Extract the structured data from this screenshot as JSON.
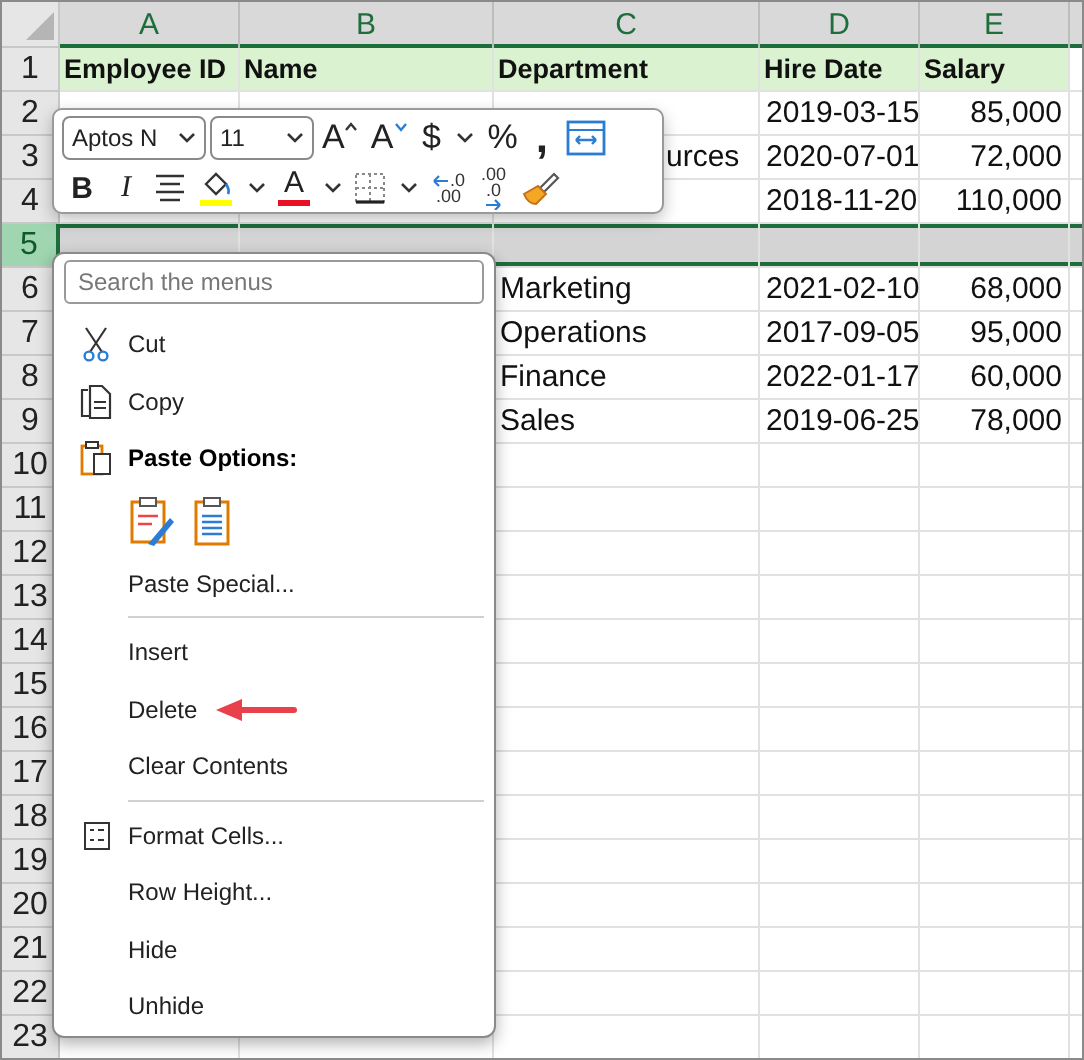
{
  "sheet": {
    "columns": [
      "A",
      "B",
      "C",
      "D",
      "E"
    ],
    "rows": [
      {
        "number": "1",
        "kind": "header",
        "selected": false,
        "cells": [
          "Employee ID",
          "Name",
          "Department",
          "Hire Date",
          "Salary"
        ]
      },
      {
        "number": "2",
        "kind": "data",
        "selected": false,
        "cells": [
          null,
          null,
          null,
          "2019-03-15",
          "85,000"
        ]
      },
      {
        "number": "3",
        "kind": "data",
        "selected": false,
        "cells": [
          null,
          null,
          "urces",
          "2020-07-01",
          "72,000"
        ]
      },
      {
        "number": "4",
        "kind": "data",
        "selected": false,
        "cells": [
          null,
          null,
          null,
          "2018-11-20",
          "110,000"
        ]
      },
      {
        "number": "5",
        "kind": "data",
        "selected": true,
        "cells": [
          null,
          null,
          null,
          null,
          null
        ]
      },
      {
        "number": "6",
        "kind": "data",
        "selected": false,
        "cells": [
          null,
          null,
          "Marketing",
          "2021-02-10",
          "68,000"
        ]
      },
      {
        "number": "7",
        "kind": "data",
        "selected": false,
        "cells": [
          null,
          null,
          "Operations",
          "2017-09-05",
          "95,000"
        ]
      },
      {
        "number": "8",
        "kind": "data",
        "selected": false,
        "cells": [
          null,
          null,
          "Finance",
          "2022-01-17",
          "60,000"
        ]
      },
      {
        "number": "9",
        "kind": "data",
        "selected": false,
        "cells": [
          null,
          null,
          "Sales",
          "2019-06-25",
          "78,000"
        ]
      },
      {
        "number": "10",
        "kind": "data",
        "selected": false,
        "cells": [
          null,
          null,
          null,
          null,
          null
        ]
      },
      {
        "number": "11",
        "kind": "data",
        "selected": false,
        "cells": [
          null,
          null,
          null,
          null,
          null
        ]
      },
      {
        "number": "12",
        "kind": "data",
        "selected": false,
        "cells": [
          null,
          null,
          null,
          null,
          null
        ]
      },
      {
        "number": "13",
        "kind": "data",
        "selected": false,
        "cells": [
          null,
          null,
          null,
          null,
          null
        ]
      },
      {
        "number": "14",
        "kind": "data",
        "selected": false,
        "cells": [
          null,
          null,
          null,
          null,
          null
        ]
      },
      {
        "number": "15",
        "kind": "data",
        "selected": false,
        "cells": [
          null,
          null,
          null,
          null,
          null
        ]
      },
      {
        "number": "16",
        "kind": "data",
        "selected": false,
        "cells": [
          null,
          null,
          null,
          null,
          null
        ]
      },
      {
        "number": "17",
        "kind": "data",
        "selected": false,
        "cells": [
          null,
          null,
          null,
          null,
          null
        ]
      },
      {
        "number": "18",
        "kind": "data",
        "selected": false,
        "cells": [
          null,
          null,
          null,
          null,
          null
        ]
      },
      {
        "number": "19",
        "kind": "data",
        "selected": false,
        "cells": [
          null,
          null,
          null,
          null,
          null
        ]
      },
      {
        "number": "20",
        "kind": "data",
        "selected": false,
        "cells": [
          null,
          null,
          null,
          null,
          null
        ]
      },
      {
        "number": "21",
        "kind": "data",
        "selected": false,
        "cells": [
          null,
          null,
          null,
          null,
          null
        ]
      },
      {
        "number": "22",
        "kind": "data",
        "selected": false,
        "cells": [
          null,
          null,
          null,
          null,
          null
        ]
      },
      {
        "number": "23",
        "kind": "data",
        "selected": false,
        "cells": [
          null,
          null,
          null,
          null,
          null
        ]
      }
    ]
  },
  "mini_toolbar": {
    "top_row": [
      {
        "kind": "font",
        "label": "Aptos N"
      },
      {
        "kind": "size",
        "label": "11"
      },
      {
        "kind": "grow",
        "label": "A"
      },
      {
        "kind": "shrink",
        "label": "A"
      },
      {
        "kind": "glyph",
        "label": "$"
      },
      {
        "kind": "caret"
      },
      {
        "kind": "glyph",
        "label": "%"
      },
      {
        "kind": "comma",
        "label": ","
      },
      {
        "kind": "wrap"
      }
    ],
    "bottom_row": [
      {
        "kind": "bold",
        "label": "B"
      },
      {
        "kind": "italic",
        "label": "I"
      },
      {
        "kind": "align"
      },
      {
        "kind": "fill",
        "color": "#ffff00"
      },
      {
        "kind": "caret"
      },
      {
        "kind": "font-color",
        "label": "A",
        "color": "#e81123"
      },
      {
        "kind": "caret"
      },
      {
        "kind": "borders"
      },
      {
        "kind": "caret"
      },
      {
        "kind": "add-decimal",
        "top": ".0",
        "bottom": ".00"
      },
      {
        "kind": "remove-decimal",
        "top": ".00",
        "bottom": ".0"
      },
      {
        "kind": "painter"
      }
    ]
  },
  "context_menu": {
    "search": {
      "placeholder": "Search the menus"
    },
    "items": [
      {
        "kind": "command",
        "label": "Cut",
        "pointed": false
      },
      {
        "kind": "command",
        "label": "Copy",
        "pointed": false
      },
      {
        "kind": "heading",
        "label": "Paste Options:"
      },
      {
        "kind": "paste-options"
      },
      {
        "kind": "command",
        "label": "Paste Special...",
        "pointed": false
      },
      {
        "kind": "separator"
      },
      {
        "kind": "command",
        "label": "Insert",
        "pointed": false
      },
      {
        "kind": "command",
        "label": "Delete",
        "pointed": true
      },
      {
        "kind": "command",
        "label": "Clear Contents",
        "pointed": false
      },
      {
        "kind": "separator"
      },
      {
        "kind": "command",
        "label": "Format Cells...",
        "pointed": false
      },
      {
        "kind": "command",
        "label": "Row Height...",
        "pointed": false
      },
      {
        "kind": "command",
        "label": "Hide",
        "pointed": false
      },
      {
        "kind": "command",
        "label": "Unhide",
        "pointed": false
      }
    ]
  }
}
